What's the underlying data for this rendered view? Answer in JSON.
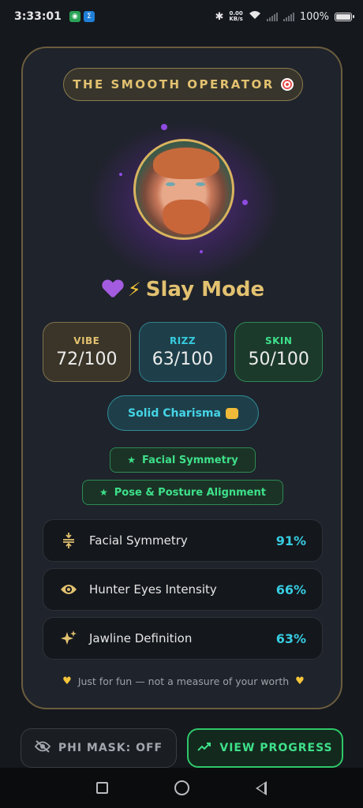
{
  "status_bar": {
    "time": "3:33:01",
    "net_speed_value": "0.00",
    "net_speed_unit": "KB/s",
    "battery": "100%"
  },
  "card": {
    "title": "THE SMOOTH OPERATOR",
    "mode_label": "Slay Mode",
    "stats": [
      {
        "label": "VIBE",
        "value": "72/100"
      },
      {
        "label": "RIZZ",
        "value": "63/100"
      },
      {
        "label": "SKIN",
        "value": "50/100"
      }
    ],
    "charisma_label": "Solid Charisma",
    "tags": [
      "Facial Symmetry",
      "Pose & Posture Alignment"
    ],
    "metrics": [
      {
        "name": "Facial Symmetry",
        "percent": "91%",
        "icon": "symmetry-icon"
      },
      {
        "name": "Hunter Eyes Intensity",
        "percent": "66%",
        "icon": "eye-icon"
      },
      {
        "name": "Jawline Definition",
        "percent": "63%",
        "icon": "sparkles-icon"
      }
    ],
    "footnote": "Just for fun — not a measure of your worth"
  },
  "actions": {
    "phi_mask": "PHI MASK: OFF",
    "view_progress": "VIEW PROGRESS"
  },
  "colors": {
    "gold": "#e2c170",
    "cyan": "#36cce0",
    "green": "#3ee08a",
    "purple": "#a35ce0"
  }
}
